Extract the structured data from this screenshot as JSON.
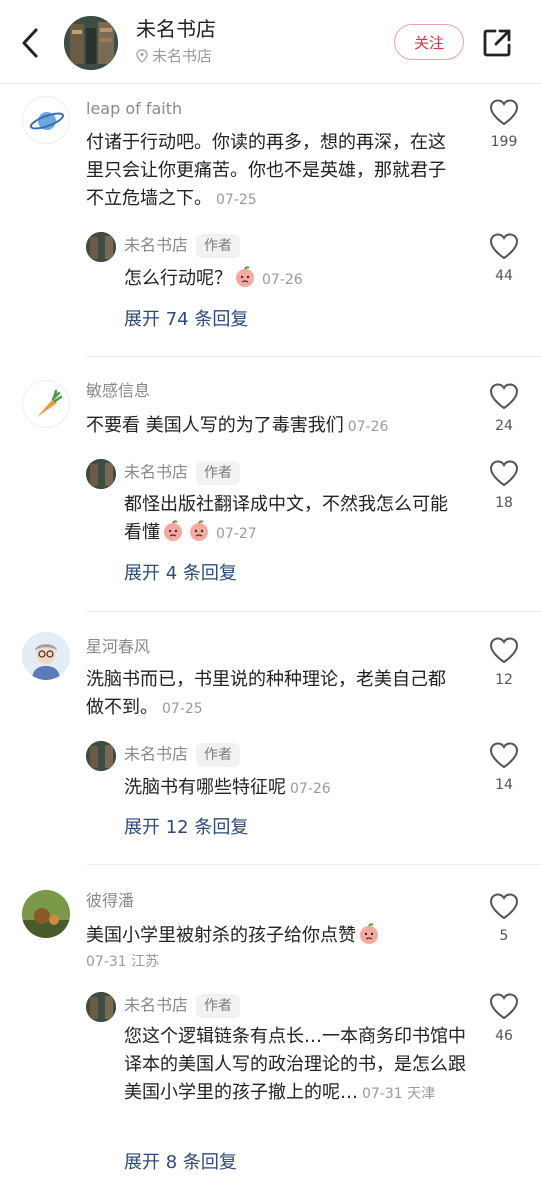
{
  "header": {
    "store_name": "未名书店",
    "location": "未名书店",
    "follow_label": "关注"
  },
  "comments": [
    {
      "author": "leap of faith",
      "text": "付诸于行动吧。你读的再多，想的再深，在这里只会让你更痛苦。你也不是英雄，那就君子不立危墙之下。",
      "date": "07-25",
      "likes": "199",
      "reply": {
        "author": "未名书店",
        "tag": "作者",
        "text": "怎么行动呢？",
        "date": "07-26",
        "likes": "44"
      },
      "expand": "展开 74 条回复"
    },
    {
      "author": "敏感信息",
      "text": "不要看 美国人写的为了毒害我们",
      "date": "07-26",
      "likes": "24",
      "reply": {
        "author": "未名书店",
        "tag": "作者",
        "text": "都怪出版社翻译成中文，不然我怎么可能看懂",
        "date": "07-27",
        "likes": "18"
      },
      "expand": "展开 4 条回复"
    },
    {
      "author": "星河春风",
      "text": "洗脑书而已，书里说的种种理论，老美自己都做不到。",
      "date": "07-25",
      "likes": "12",
      "reply": {
        "author": "未名书店",
        "tag": "作者",
        "text": "洗脑书有哪些特征呢",
        "date": "07-26",
        "likes": "14"
      },
      "expand": "展开 12 条回复"
    },
    {
      "author": "彼得潘",
      "text": "美国小学里被射杀的孩子给你点赞",
      "date": "07-31 江苏",
      "likes": "5",
      "reply": {
        "author": "未名书店",
        "tag": "作者",
        "text": "您这个逻辑链条有点长…一本商务印书馆中译本的美国人写的政治理论的书，是怎么跟美国小学里的孩子撤上的呢…",
        "date": "07-31 天津",
        "likes": "46"
      },
      "expand": "展开 8 条回复"
    }
  ],
  "icons": {
    "back": "chevron-left-icon",
    "share": "share-external-icon",
    "like": "heart-outline-icon",
    "location": "location-pin-icon"
  },
  "colors": {
    "accent": "#e0344b",
    "link": "#2d4a7a",
    "muted": "#9a9a9a"
  }
}
